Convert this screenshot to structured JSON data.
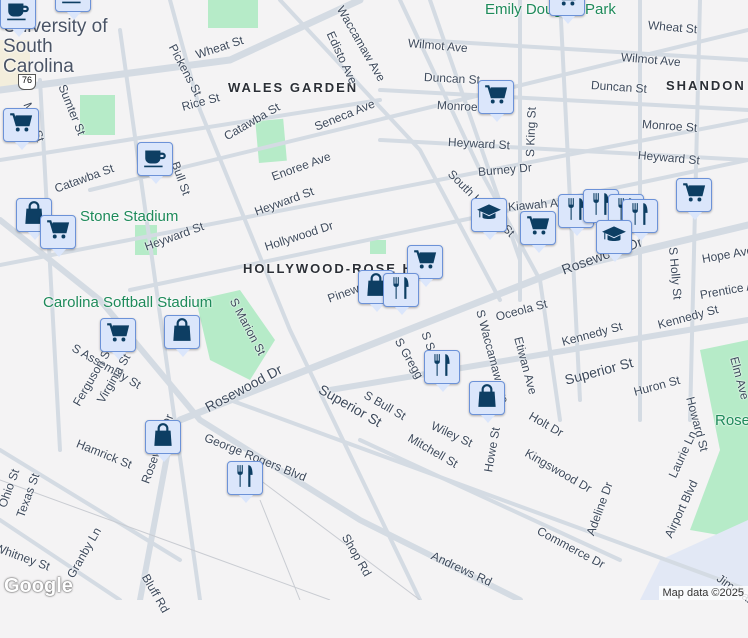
{
  "neighborhoods": [
    "WALES GARDEN",
    "HOLLYWOOD-ROSE HILL",
    "SHANDON"
  ],
  "places": [
    "University of South Carolina",
    "Stone Stadium",
    "Carolina Softball Stadium",
    "Emily Douglas Park",
    "Rosewood Park"
  ],
  "streets": [
    "Wheat St",
    "Pickens St",
    "Rice St",
    "Catawba St",
    "Seneca Ave",
    "Enoree Ave",
    "Heyward St",
    "Hollywood Dr",
    "Bull St",
    "Sumter St",
    "Main St",
    "Catawba St",
    "Heyward St",
    "Edisto Ave",
    "Waccamaw Ave",
    "S Marion St",
    "Pinewood",
    "Wilmot Ave",
    "Duncan St",
    "Monroe St",
    "Heyward St",
    "Burney Dr",
    "S King St",
    "Kiawah Ave",
    "South Harden St",
    "Wheat St",
    "Wilmot Ave",
    "Duncan St",
    "Monroe St",
    "Heyward St",
    "Rosewood Dr",
    "Hope Ave",
    "Prentice Ave",
    "S Holly St",
    "S Assembly St",
    "Ferguson St",
    "Virginia St",
    "Hamrick St",
    "Rosewood Dr",
    "George Rogers Blvd",
    "Rosewood Dr",
    "Ohio St",
    "Texas St",
    "Granby Ln",
    "Bluff Rd",
    "Shop Rd",
    "Whitney St",
    "Superior St",
    "S Bull St",
    "Oceola St",
    "S Gregg",
    "S Saluda",
    "S Waccamaw Ave",
    "Etiwan Ave",
    "Kennedy St",
    "Kennedy St",
    "Superior St",
    "Howard St",
    "Huron St",
    "Holt Dr",
    "Wiley St",
    "Mitchell St",
    "Kingswood Dr",
    "Howe St",
    "Adeline Dr",
    "Commerce Dr",
    "Andrews Rd",
    "Airport Blvd",
    "Laurie Ln",
    "Elm Ave",
    "Jim Hamilton Blvd"
  ],
  "route_shield": "76",
  "markers": [
    "cup",
    "cup",
    "cart",
    "cup",
    "bag",
    "cart",
    "cart",
    "cart",
    "school",
    "cart",
    "fork",
    "fork",
    "fork",
    "fork",
    "school",
    "cart",
    "cart",
    "bag",
    "fork",
    "cart",
    "bag",
    "fork",
    "bag",
    "bag",
    "fork"
  ],
  "footer": {
    "logo": "Google",
    "attribution": "Map data ©2025"
  }
}
